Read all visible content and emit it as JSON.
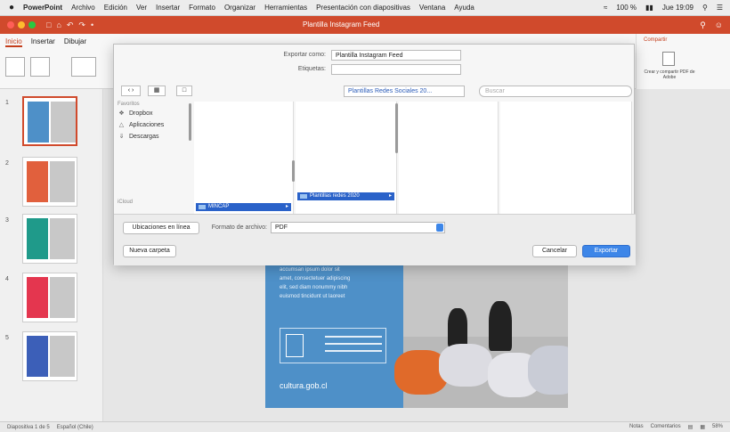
{
  "menubar": {
    "app": "PowerPoint",
    "items": [
      "Archivo",
      "Edición",
      "Ver",
      "Insertar",
      "Formato",
      "Organizar",
      "Herramientas",
      "Presentación con diapositivas",
      "Ventana",
      "Ayuda"
    ],
    "zoom": "100 %",
    "clock": "Jue 19:09"
  },
  "window": {
    "title": "Plantilla Instagram Feed"
  },
  "ribbon": {
    "tabs": [
      "Inicio",
      "Insertar",
      "Dibujar"
    ],
    "share_tab": "Compartir",
    "share_label": "Crear y compartir PDF de Adobe"
  },
  "dialog": {
    "export_as_label": "Exportar como:",
    "export_as_value": "Plantilla Instagram Feed",
    "tags_label": "Etiquetas:",
    "tags_value": "",
    "location": "Plantillas Redes Sociales 20...",
    "search_placeholder": "Buscar",
    "sidebar": {
      "favorites": "Favoritos",
      "items": [
        {
          "icon": "dropbox-icon",
          "label": "Dropbox"
        },
        {
          "icon": "applications-icon",
          "label": "Aplicaciones"
        },
        {
          "icon": "downloads-icon",
          "label": "Descargas"
        }
      ],
      "shared": "iCloud"
    },
    "column1_selected": "MINCAP",
    "column2_selected": "Plantillas redes 2020",
    "online_locations": "Ubicaciones en línea",
    "file_format_label": "Formato de archivo:",
    "file_format_value": "PDF",
    "new_folder": "Nueva carpeta",
    "cancel": "Cancelar",
    "export": "Exportar"
  },
  "thumbnails": [
    {
      "number": "1",
      "color": "#4e90c8"
    },
    {
      "number": "2",
      "color": "#e1603d"
    },
    {
      "number": "3",
      "color": "#1f9a8a"
    },
    {
      "number": "4",
      "color": "#e4364f"
    },
    {
      "number": "5",
      "color": "#3c5fb8"
    }
  ],
  "slide": {
    "body_lines": [
      "accumsan ipsum dolor sit",
      "amet, consectetuer adipiscing",
      "elit, sed diam nonummy nibh",
      "euismod tincidunt ut laoreet"
    ],
    "url": "cultura.gob.cl"
  },
  "status": {
    "slide_info": "Diapositiva 1 de 5",
    "language": "Español (Chile)",
    "notes": "Notas",
    "comments": "Comentarios",
    "zoom": "58%"
  },
  "colors": {
    "accent": "#d04a2c",
    "primary_button": "#3d86e8",
    "slide_blue": "#4e90c8"
  }
}
